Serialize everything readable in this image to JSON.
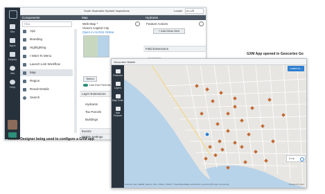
{
  "designer": {
    "app_title": "South Swanwick Hydrant Inspections",
    "locale_label": "Locale",
    "locale_value": "en-US",
    "rail": [
      {
        "label": "Site"
      },
      {
        "label": "Apps"
      },
      {
        "label": "Deploy"
      },
      {
        "label": "Info"
      },
      {
        "label": "Help"
      }
    ],
    "components_title": "Components",
    "filter_placeholder": "Filter",
    "components": [
      "App",
      "Branding",
      "Highlighting",
      "I Want To Menu",
      "Launch Link Workflow",
      "Map",
      "Region",
      "Result Details",
      "Search"
    ],
    "map_panel": {
      "title": "Map",
      "web_map_label": "Web Map *",
      "web_map_name": "Clara's Capitol City",
      "web_map_link": "Open in ArcGIS Online",
      "select_button": "Select",
      "use_field_label": "Use Esri Field Maps",
      "layer_extensions": "Layer Extensions",
      "layers": [
        "Hydrants",
        "Tax Parcels",
        "Buildings"
      ],
      "events": "Events",
      "bmds": "BMDS Settings"
    },
    "hydrants_panel": {
      "title": "Hydrants",
      "feature_actions": "Feature Actions",
      "add_button": "+ Add Menu Item",
      "field_extensions": "Field Extensions",
      "objectid": "OBJECTID"
    }
  },
  "gxm": {
    "title": "Geocortex Mobile",
    "nav": [
      {
        "label": "Features"
      },
      {
        "label": "Layers"
      },
      {
        "label": "Map Tools"
      },
      {
        "label": "Add Feature"
      }
    ],
    "top_button": "I want to...",
    "scale": "2 mi",
    "attribution": "Sources: Esri, HERE, Garmin, FAO, NOAA, USGS, © OpenStreetMap contributors, and the GIS User Community",
    "powered": "Powered by Esri",
    "hydrant_count": 40
  },
  "captions": {
    "designer": "Mobile Designer being used to configure a GXM app",
    "gxm": "GXM App opened in Geocortex Go"
  },
  "colors": {
    "rail": "#27313c",
    "accent": "#2f7fd0",
    "hydrant": "#c26a33",
    "water": "#b7d3ea",
    "land": "#e8e6e2"
  }
}
